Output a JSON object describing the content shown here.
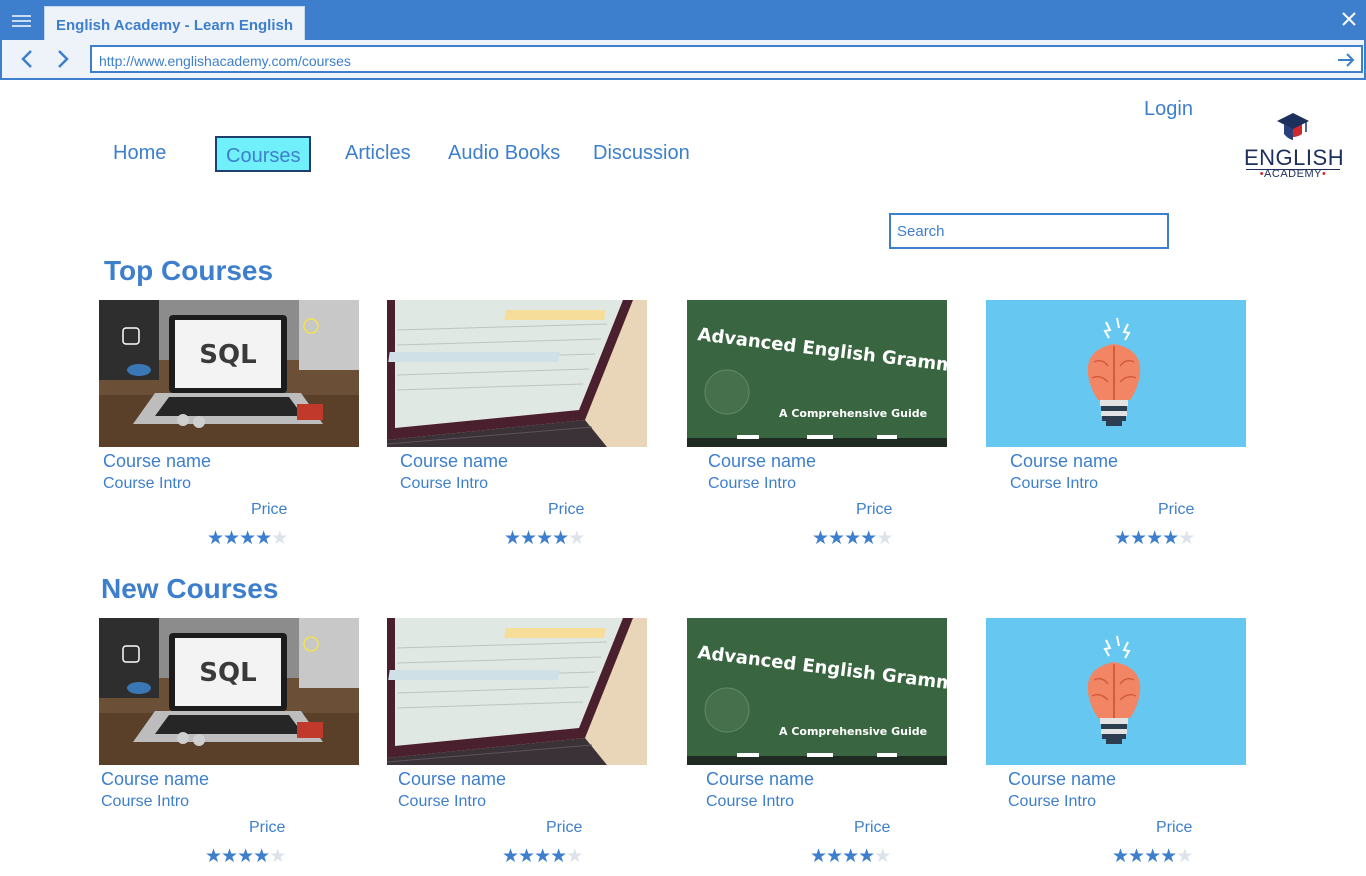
{
  "browser": {
    "tab_title": "English Academy - Learn English",
    "url": "http://www.englishacademy.com/courses"
  },
  "header": {
    "login_label": "Login",
    "logo": {
      "word": "ENGLISH",
      "sub": "ACADEMY"
    },
    "nav": [
      {
        "label": "Home",
        "active": false
      },
      {
        "label": "Courses",
        "active": true
      },
      {
        "label": "Articles",
        "active": false
      },
      {
        "label": "Audio Books",
        "active": false
      },
      {
        "label": "Discussion",
        "active": false
      }
    ],
    "search_placeholder": "Search"
  },
  "sections": [
    {
      "title": "Top Courses",
      "courses": [
        {
          "image": "sql-laptop-image",
          "name": "Course name",
          "intro": "Course Intro",
          "price": "Price",
          "rating": 4,
          "rating_max": 5
        },
        {
          "image": "laptop-spreadsheet-image",
          "name": "Course name",
          "intro": "Course Intro",
          "price": "Price",
          "rating": 4,
          "rating_max": 5
        },
        {
          "image": "chalkboard-grammar-image",
          "name": "Course name",
          "intro": "Course Intro",
          "price": "Price",
          "rating": 4,
          "rating_max": 5
        },
        {
          "image": "brain-lightbulb-image",
          "name": "Course name",
          "intro": "Course Intro",
          "price": "Price",
          "rating": 4,
          "rating_max": 5
        }
      ]
    },
    {
      "title": "New Courses",
      "courses": [
        {
          "image": "sql-laptop-image",
          "name": "Course name",
          "intro": "Course Intro",
          "price": "Price",
          "rating": 4,
          "rating_max": 5
        },
        {
          "image": "laptop-spreadsheet-image",
          "name": "Course name",
          "intro": "Course Intro",
          "price": "Price",
          "rating": 4,
          "rating_max": 5
        },
        {
          "image": "chalkboard-grammar-image",
          "name": "Course name",
          "intro": "Course Intro",
          "price": "Price",
          "rating": 4,
          "rating_max": 5
        },
        {
          "image": "brain-lightbulb-image",
          "name": "Course name",
          "intro": "Course Intro",
          "price": "Price",
          "rating": 4,
          "rating_max": 5
        }
      ]
    }
  ],
  "images": {
    "sql_text": "SQL",
    "chalkboard_title": "Advanced English Grammar",
    "chalkboard_subtitle": "A Comprehensive Guide"
  },
  "colors": {
    "accent": "#3d7fcc",
    "active_tab_fill": "#6ff0fb",
    "chrome_light": "#eef3fa",
    "logo_navy": "#1d2f5b",
    "logo_red": "#d0282f",
    "star_empty": "#dde3ea"
  }
}
